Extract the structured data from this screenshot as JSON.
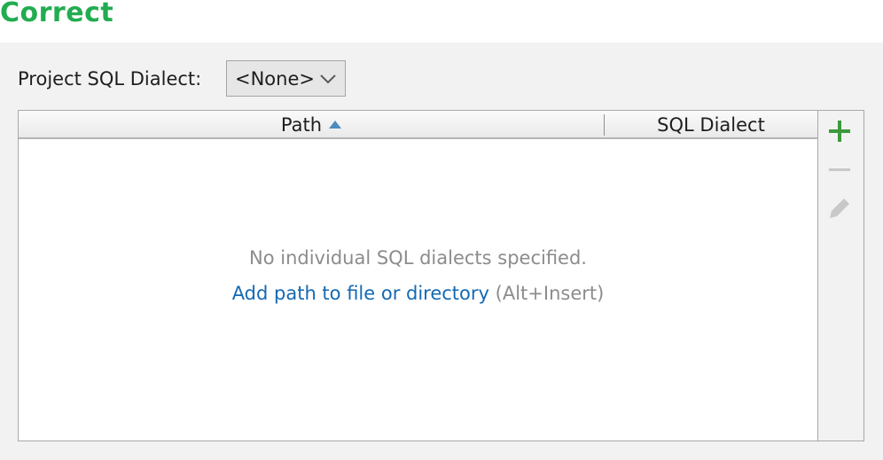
{
  "heading": "Correct",
  "project_dialect": {
    "label": "Project SQL Dialect:",
    "selected": "<None>"
  },
  "table": {
    "columns": [
      "Path",
      "SQL Dialect"
    ],
    "sort_column": "Path",
    "sort_direction": "ascending",
    "rows": [],
    "empty_text": "No individual SQL dialects specified.",
    "add_link": "Add path to file or directory",
    "add_shortcut": "(Alt+Insert)"
  },
  "toolbar": {
    "buttons": [
      {
        "icon": "plus-icon",
        "enabled": true,
        "color": "#3c9a3c"
      },
      {
        "icon": "minus-icon",
        "enabled": false
      },
      {
        "icon": "pencil-icon",
        "enabled": false
      }
    ]
  },
  "colors": {
    "heading": "#22ac50",
    "link": "#1469b3",
    "muted_text": "#8c8c8c",
    "panel_bg": "#f2f2f2"
  }
}
